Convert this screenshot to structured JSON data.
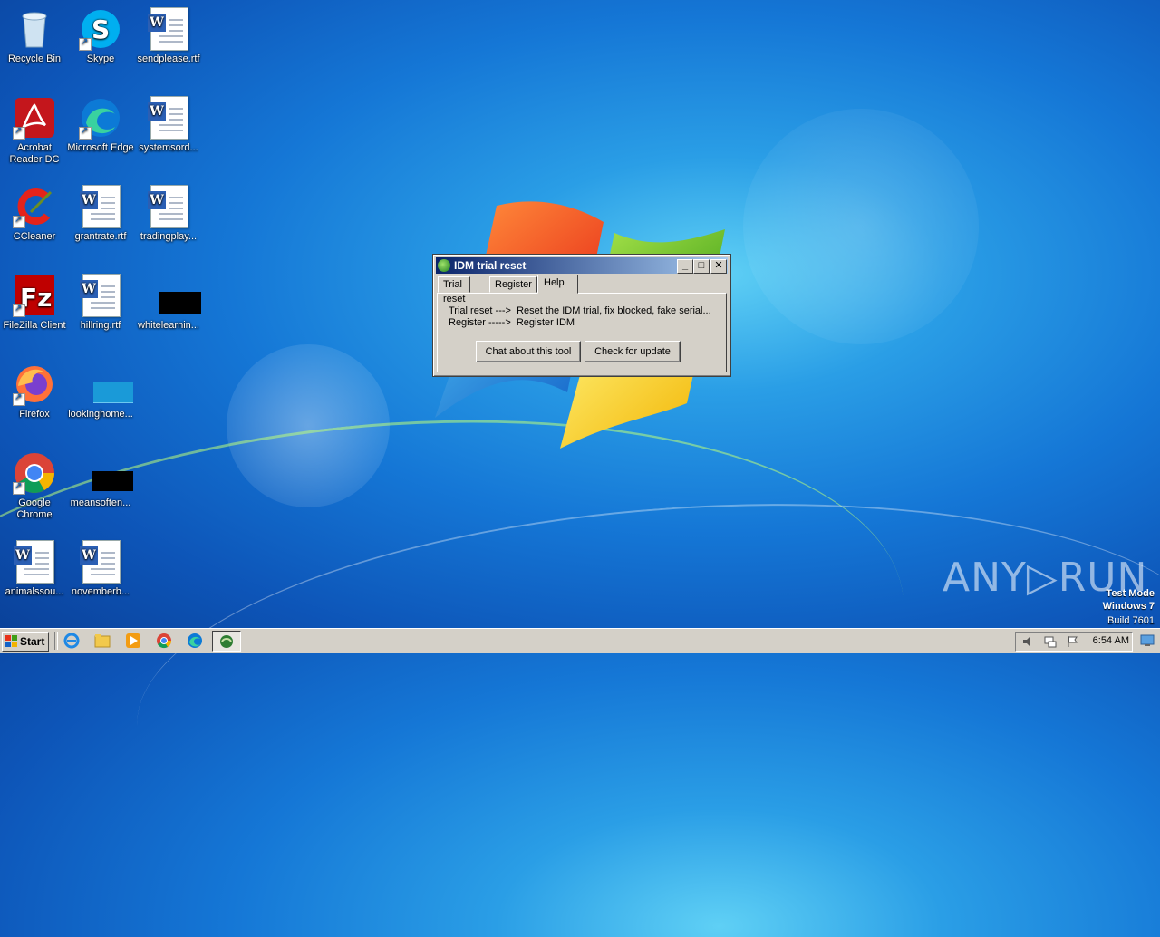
{
  "desktop": {
    "icons": [
      {
        "label": "Recycle Bin"
      },
      {
        "label": "Skype"
      },
      {
        "label": "sendplease.rtf"
      },
      {
        "label": "Acrobat Reader DC"
      },
      {
        "label": "Microsoft Edge"
      },
      {
        "label": "systemsord..."
      },
      {
        "label": "CCleaner"
      },
      {
        "label": "grantrate.rtf"
      },
      {
        "label": "tradingplay..."
      },
      {
        "label": "FileZilla Client"
      },
      {
        "label": "hillring.rtf"
      },
      {
        "label": "whitelearnin..."
      },
      {
        "label": "Firefox"
      },
      {
        "label": "lookinghome..."
      },
      {
        "label": "Google Chrome"
      },
      {
        "label": "meansoften..."
      },
      {
        "label": "animalssou..."
      },
      {
        "label": "novemberb..."
      }
    ]
  },
  "dialog": {
    "title": "IDM trial reset",
    "tabs": [
      {
        "label": "Trial reset"
      },
      {
        "label": "Register"
      },
      {
        "label": "Help",
        "active": true
      }
    ],
    "help_line1": "Trial reset --->  Reset the IDM trial, fix blocked, fake serial...",
    "help_line2": "Register ----->  Register IDM",
    "chat_button": "Chat about this tool",
    "update_button": "Check for update",
    "minimize_glyph": "_",
    "maximize_glyph": "□",
    "close_glyph": "✕"
  },
  "taskbar": {
    "start_label": "Start",
    "clock": "6:54 AM",
    "pinned": [
      "internet-explorer-icon",
      "explorer-folder-icon",
      "media-player-icon",
      "chrome-icon",
      "edge-icon",
      "idm-reset-icon"
    ]
  },
  "watermark": {
    "brand": "ANY▷RUN",
    "line1": "Test Mode",
    "line2": "Windows 7",
    "line3": "Build 7601"
  },
  "colors": {
    "desktop_bg": "#1577d6",
    "titlebar_start": "#0a246a",
    "titlebar_end": "#a6caf0",
    "dialog_face": "#d4d0c8"
  }
}
